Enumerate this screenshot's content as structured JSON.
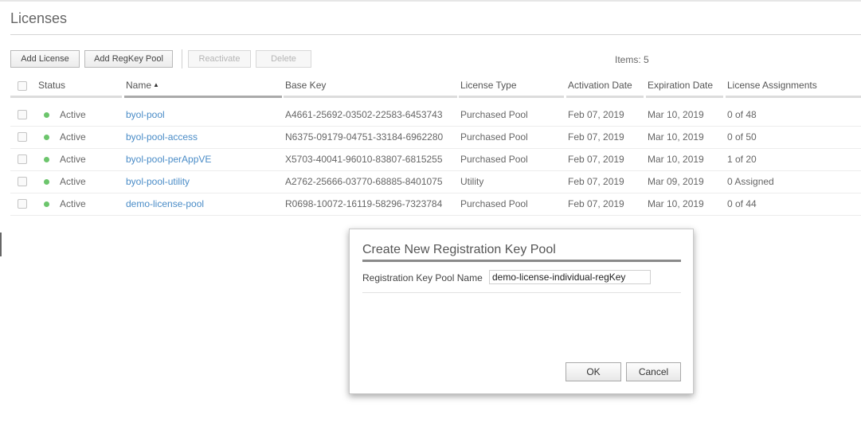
{
  "page": {
    "title": "Licenses"
  },
  "toolbar": {
    "add_license": "Add License",
    "add_regkey_pool": "Add RegKey Pool",
    "reactivate": "Reactivate",
    "delete": "Delete",
    "items_count": "Items: 5"
  },
  "table": {
    "columns": {
      "status": "Status",
      "name": "Name",
      "base_key": "Base Key",
      "license_type": "License Type",
      "activation_date": "Activation Date",
      "expiration_date": "Expiration Date",
      "license_assignments": "License Assignments"
    },
    "sorted_column": "Name",
    "sort_direction": "ascending",
    "rows": [
      {
        "status": "Active",
        "name": "byol-pool",
        "base_key": "A4661-25692-03502-22583-6453743",
        "license_type": "Purchased Pool",
        "activation_date": "Feb 07, 2019",
        "expiration_date": "Mar 10, 2019",
        "license_assignments": "0 of 48"
      },
      {
        "status": "Active",
        "name": "byol-pool-access",
        "base_key": "N6375-09179-04751-33184-6962280",
        "license_type": "Purchased Pool",
        "activation_date": "Feb 07, 2019",
        "expiration_date": "Mar 10, 2019",
        "license_assignments": "0 of 50"
      },
      {
        "status": "Active",
        "name": "byol-pool-perAppVE",
        "base_key": "X5703-40041-96010-83807-6815255",
        "license_type": "Purchased Pool",
        "activation_date": "Feb 07, 2019",
        "expiration_date": "Mar 10, 2019",
        "license_assignments": "1 of 20"
      },
      {
        "status": "Active",
        "name": "byol-pool-utility",
        "base_key": "A2762-25666-03770-68885-8401075",
        "license_type": "Utility",
        "activation_date": "Feb 07, 2019",
        "expiration_date": "Mar 09, 2019",
        "license_assignments": "0 Assigned"
      },
      {
        "status": "Active",
        "name": "demo-license-pool",
        "base_key": "R0698-10072-16119-58296-7323784",
        "license_type": "Purchased Pool",
        "activation_date": "Feb 07, 2019",
        "expiration_date": "Mar 10, 2019",
        "license_assignments": "0 of 44"
      }
    ]
  },
  "dialog": {
    "title": "Create New Registration Key Pool",
    "field_label": "Registration Key Pool Name",
    "field_value": "demo-license-individual-regKey",
    "ok": "OK",
    "cancel": "Cancel"
  },
  "colors": {
    "link": "#4a8cc7",
    "status_active": "#6cc56c",
    "text": "#666666"
  }
}
